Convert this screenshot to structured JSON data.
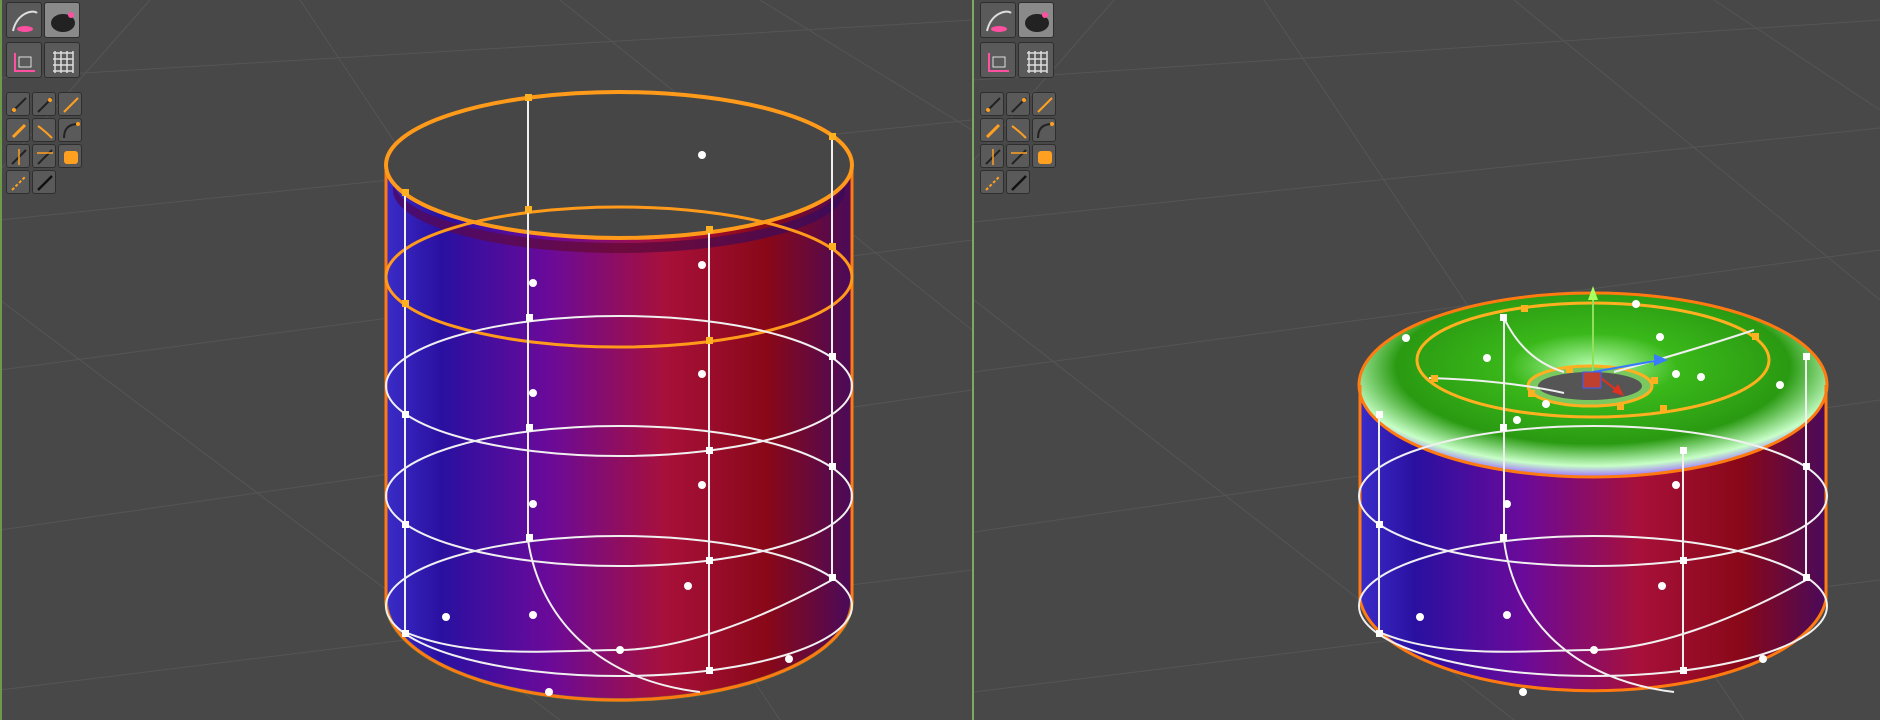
{
  "app": {
    "layout": "dual-viewport-3d-modeler"
  },
  "viewports": [
    {
      "id": "left",
      "model": "cylinder-shell",
      "selection_color": "#ff9a1a"
    },
    {
      "id": "right",
      "model": "cylinder-with-torus-cap",
      "selection_color": "#ff9a1a"
    }
  ],
  "toolbar": {
    "primary_tools": [
      "curve-draw-icon",
      "sculpt-brush-icon",
      "deform-icon",
      "grid-icon"
    ],
    "secondary_tools": [
      "line-tool-icon",
      "line-tool-alt-icon",
      "pen-tool-icon",
      "brush-tool-icon",
      "bend-tool-icon",
      "arc-tool-icon",
      "split-tool-icon",
      "pin-tool-icon",
      "fill-tool-icon",
      "smooth-tool-icon",
      "knife-tool-icon"
    ]
  },
  "colors": {
    "viewport_bg": "#484848",
    "grid_line": "#5a5a5a",
    "selection_orange": "#ff9a1a",
    "wire_white": "#f2f2f2",
    "gradient_blue": "#2a1aa8",
    "gradient_purple": "#5a0aa0",
    "gradient_red": "#a80a2a",
    "gradient_green": "#3ab81a"
  }
}
